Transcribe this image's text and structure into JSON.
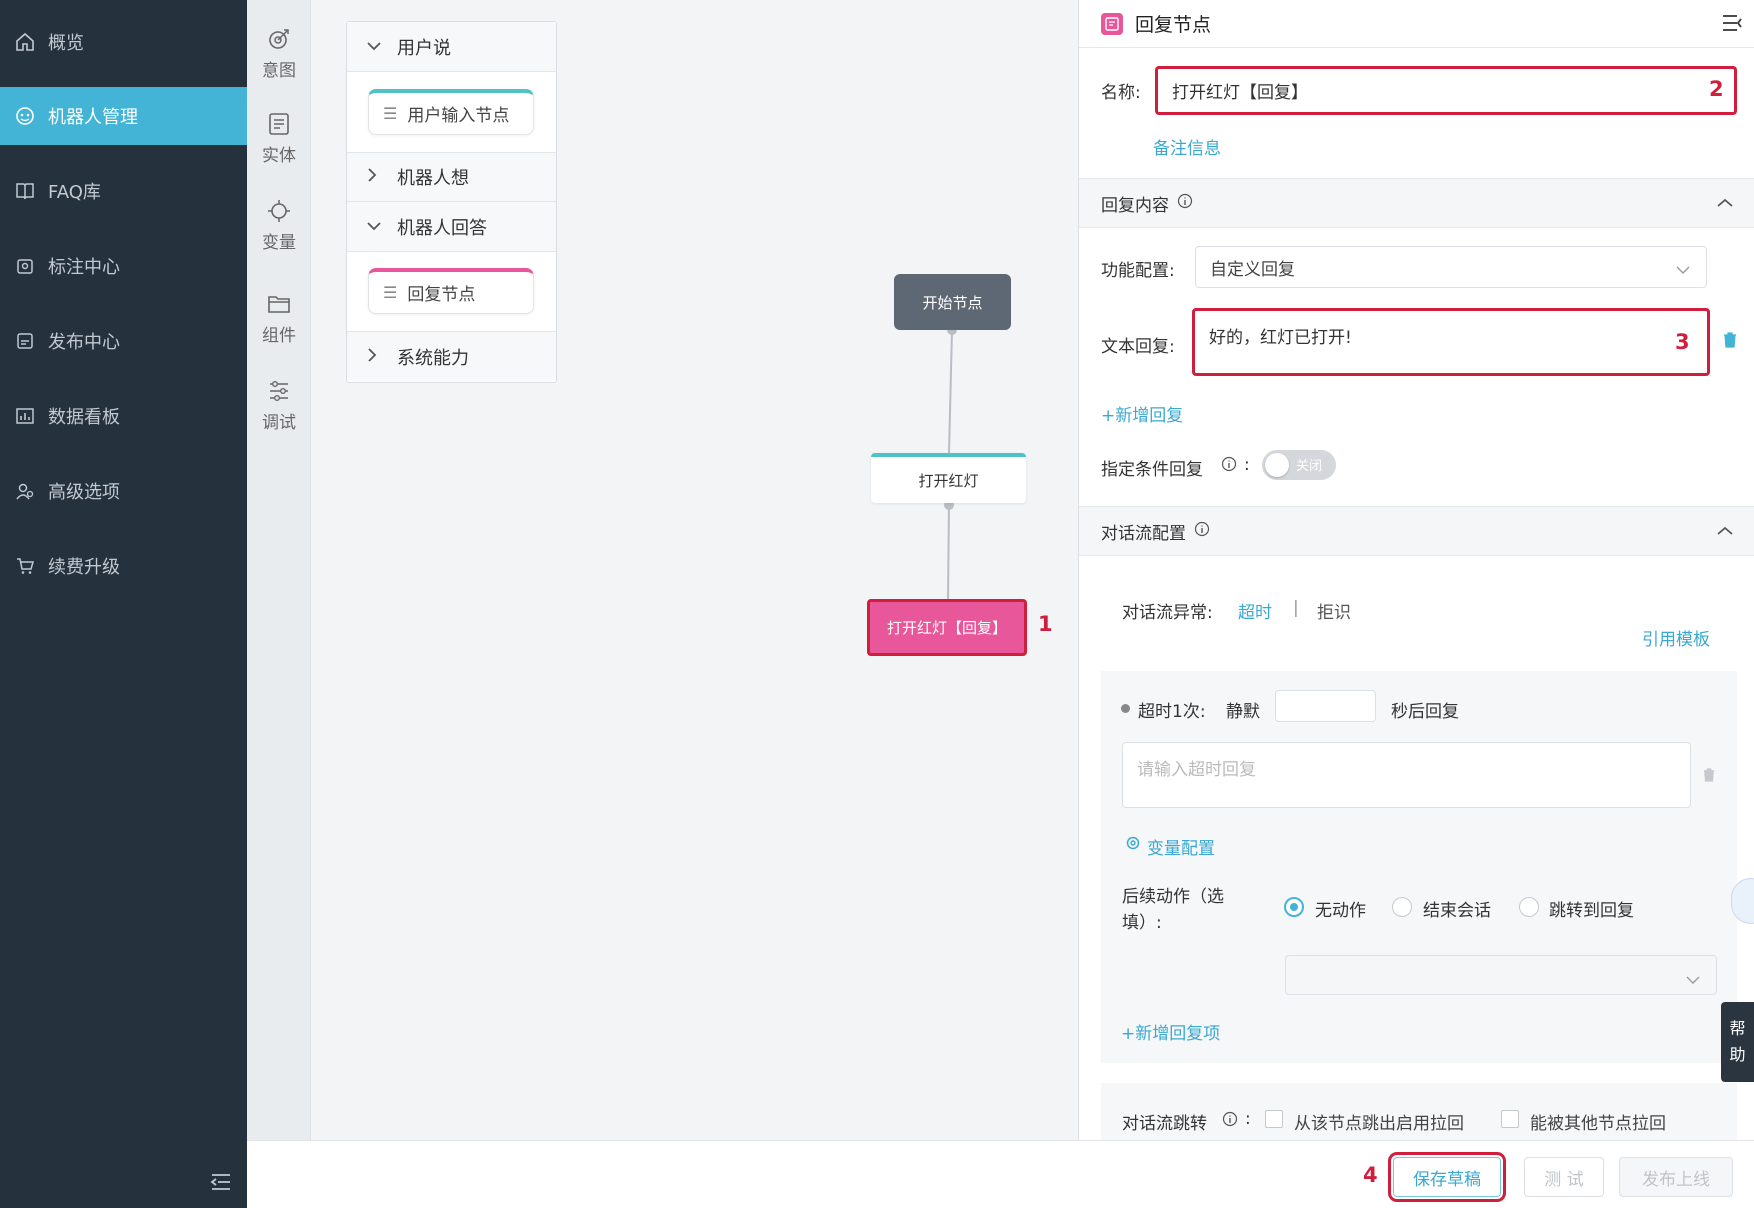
{
  "sidebar": {
    "items": [
      {
        "label": "概览",
        "icon": "home-icon"
      },
      {
        "label": "机器人管理",
        "icon": "robot-icon",
        "active": true
      },
      {
        "label": "FAQ库",
        "icon": "book-icon"
      },
      {
        "label": "标注中心",
        "icon": "tag-icon"
      },
      {
        "label": "发布中心",
        "icon": "publish-icon"
      },
      {
        "label": "数据看板",
        "icon": "chart-icon"
      },
      {
        "label": "高级选项",
        "icon": "users-icon"
      },
      {
        "label": "续费升级",
        "icon": "cart-icon"
      }
    ]
  },
  "tools": [
    {
      "label": "意图",
      "icon": "target-icon"
    },
    {
      "label": "实体",
      "icon": "document-icon"
    },
    {
      "label": "变量",
      "icon": "crosshair-icon"
    },
    {
      "label": "组件",
      "icon": "folder-icon"
    },
    {
      "label": "调试",
      "icon": "sliders-icon"
    }
  ],
  "palette": {
    "group_user": "用户说",
    "node_user_input": "用户输入节点",
    "group_robot_think": "机器人想",
    "group_robot_answer": "机器人回答",
    "node_reply": "回复节点",
    "group_system": "系统能力"
  },
  "flow": {
    "start_node": "开始节点",
    "intent_node": "打开红灯",
    "reply_node": "打开红灯【回复】"
  },
  "annotations": {
    "a1": "1",
    "a2": "2",
    "a3": "3",
    "a4": "4"
  },
  "panel": {
    "title": "回复节点",
    "name_label": "名称:",
    "name_value": "打开红灯【回复】",
    "note_link": "备注信息",
    "reply_content_section": "回复内容",
    "function_label": "功能配置:",
    "function_value": "自定义回复",
    "text_reply_label": "文本回复:",
    "text_reply_value": "好的，红灯已打开!",
    "add_reply": "+新增回复",
    "cond_reply_label": "指定条件回复",
    "cond_colon": ":",
    "toggle_label": "关闭",
    "flow_config_section": "对话流配置",
    "exception_label": "对话流异常:",
    "tab_timeout": "超时",
    "tab_sep": "|",
    "tab_reject": "拒识",
    "template_link": "引用模板",
    "timeout_prefix": "超时1次:",
    "silent_label": "静默",
    "seconds_suffix": "秒后回复",
    "timeout_placeholder": "请输入超时回复",
    "var_config": "变量配置",
    "followup_label_1": "后续动作（选",
    "followup_label_2": "填）:",
    "radio_no_action": "无动作",
    "radio_end_session": "结束会话",
    "radio_jump": "跳转到回复",
    "add_reply_item": "+新增回复项",
    "jump_label": "对话流跳转",
    "jump_colon": ":",
    "check_jump_out": "从该节点跳出启用拉回",
    "check_pulled_back": "能被其他节点拉回"
  },
  "footer": {
    "save_draft": "保存草稿",
    "test": "测 试",
    "publish": "发布上线"
  },
  "help": {
    "char1": "帮",
    "char2": "助"
  },
  "colors": {
    "sidebar_bg": "#25313d",
    "active": "#43b4d6",
    "reply_pink": "#e85799",
    "annotation_red": "#d01f3c",
    "teal": "#4fc2c6"
  }
}
